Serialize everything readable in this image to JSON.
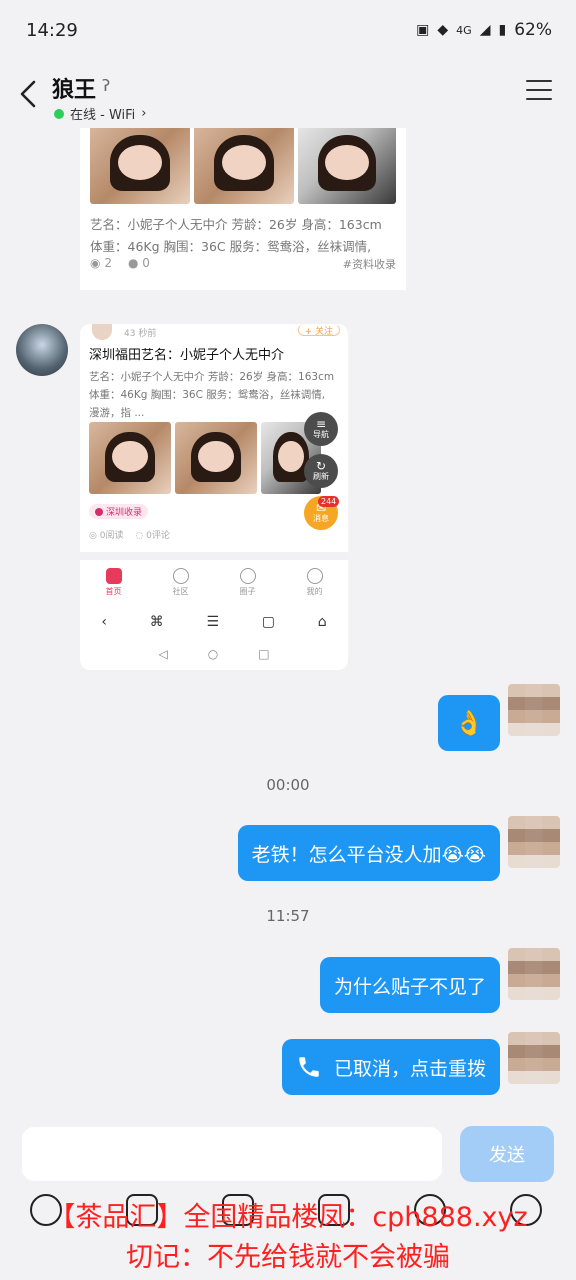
{
  "status": {
    "time": "14:29",
    "network": "4G",
    "battery": "62%"
  },
  "header": {
    "title": "狼王",
    "presence": "在线 - WiFi",
    "presence_color": "#2fce5c"
  },
  "card1": {
    "desc_line1": "艺名：小妮子个人无中介 芳龄：26岁 身高：163cm",
    "desc_line2": "体重：46Kg 胸围：36C 服务：鸳鸯浴，丝袜调情,",
    "views": "2",
    "comments": "0",
    "tag": "#资料收录"
  },
  "card2": {
    "time_ago": "43 秒前",
    "follow": "+ 关注",
    "title": "深圳福田艺名：小妮子个人无中介",
    "desc_line1": "艺名：小妮子个人无中介 芳龄：26岁 身高：163cm",
    "desc_line2": "体重：46Kg 胸围：36C 服务：鸳鸯浴，丝袜调情,",
    "desc_line3": "漫游，指 ...",
    "fab_nav": "导航",
    "fab_refresh": "刷新",
    "fab_msg": "消息",
    "badge": "244",
    "pill": "深圳收录",
    "reads": "0阅读",
    "comments": "0评论",
    "tabs": [
      "首页",
      "社区",
      "圈子",
      "我的"
    ]
  },
  "messages": [
    {
      "type": "emoji",
      "text": "👌"
    },
    {
      "type": "timestamp",
      "text": "00:00"
    },
    {
      "type": "text",
      "text": "老铁！怎么平台没人加😭😭"
    },
    {
      "type": "timestamp",
      "text": "11:57"
    },
    {
      "type": "text",
      "text": "为什么贴子不见了"
    },
    {
      "type": "call",
      "text": "已取消，点击重拨"
    }
  ],
  "input": {
    "placeholder": "",
    "send_label": "发送"
  },
  "overlay": {
    "line1": "【茶品汇】全国精品楼凤：cph888.xyz",
    "line2": "切记：不先给钱就不会被骗",
    "color": "#ff2020"
  },
  "colors": {
    "bubble": "#1e96f3",
    "send_disabled": "#a3cdf6"
  }
}
